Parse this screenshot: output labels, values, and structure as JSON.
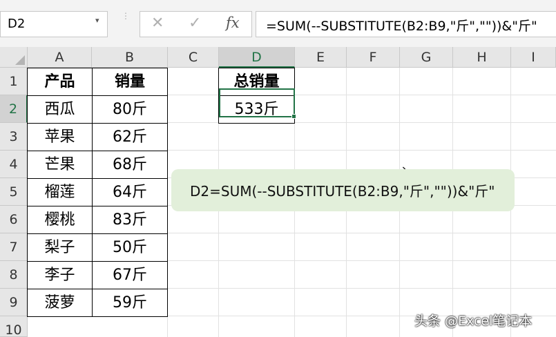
{
  "formula_bar": {
    "name_box": "D2",
    "name_box_arrow": "▾",
    "cancel_icon": "✕",
    "enter_icon": "✓",
    "fx_label": "fx",
    "formula": "=SUM(--SUBSTITUTE(B2:B9,\"斤\",\"\"))&\"斤\""
  },
  "columns": [
    "A",
    "B",
    "C",
    "D",
    "E",
    "F",
    "G",
    "H",
    "I"
  ],
  "rows": [
    "1",
    "2",
    "3",
    "4",
    "5",
    "6",
    "7",
    "8",
    "9",
    "10"
  ],
  "table": {
    "headers": [
      "产品",
      "销量"
    ],
    "rows": [
      [
        "西瓜",
        "80斤"
      ],
      [
        "苹果",
        "62斤"
      ],
      [
        "芒果",
        "68斤"
      ],
      [
        "榴莲",
        "64斤"
      ],
      [
        "樱桃",
        "83斤"
      ],
      [
        "梨子",
        "50斤"
      ],
      [
        "李子",
        "67斤"
      ],
      [
        "菠萝",
        "59斤"
      ]
    ]
  },
  "result": {
    "header": "总销量",
    "value": "533斤"
  },
  "note": "D2=SUM(--SUBSTITUTE(B2:B9,\"斤\",\"\"))&\"斤\"",
  "stray_mark": "、",
  "watermark": "头条 @Excel笔记本",
  "colors": {
    "accent": "#217346",
    "note_bg": "#e2efda",
    "header_bg": "#e6e6e6"
  }
}
